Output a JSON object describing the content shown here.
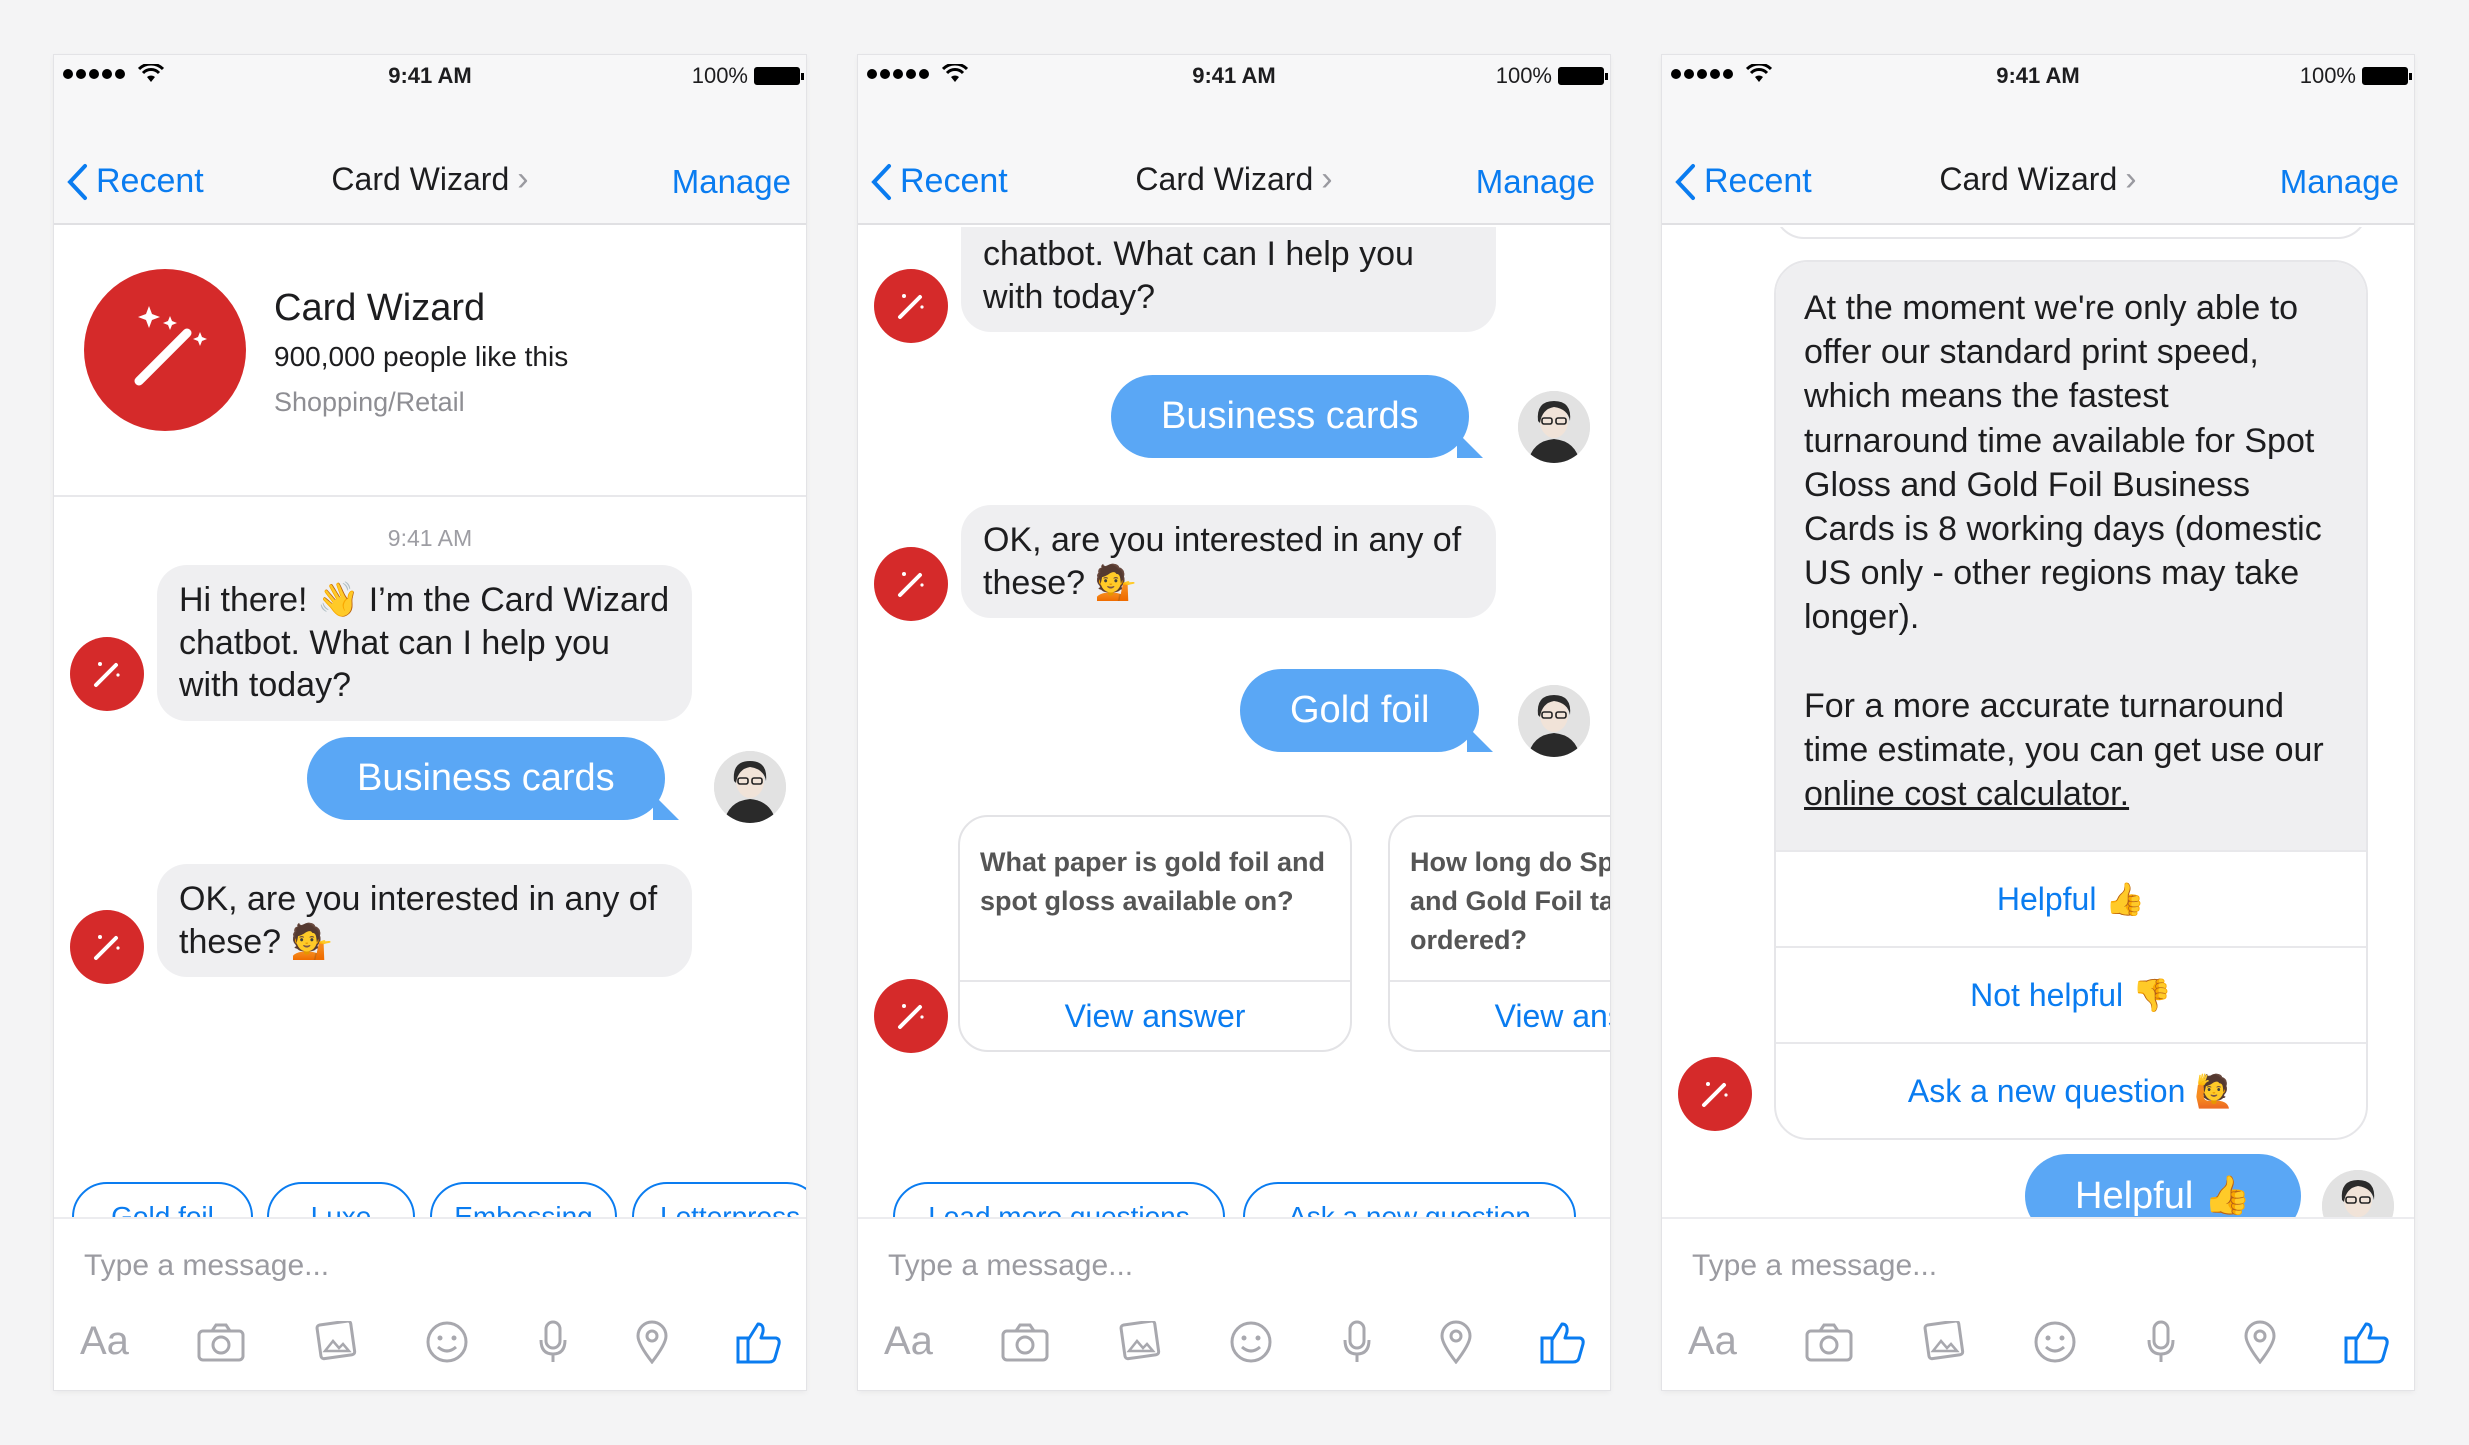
{
  "status": {
    "time": "9:41 AM",
    "battery": "100%"
  },
  "nav": {
    "back": "Recent",
    "title": "Card Wizard",
    "manage": "Manage"
  },
  "input_placeholder": "Type a message...",
  "aa": "Aa",
  "accent": "#0a7cf0",
  "bot_color": "#d52a2a",
  "user_bubble_color": "#5aa7f5",
  "screen1": {
    "profile": {
      "name": "Card Wizard",
      "likes": "900,000 people like this",
      "category": "Shopping/Retail"
    },
    "timestamp": "9:41 AM",
    "msg1": "Hi there! 👋 I’m the Card Wizard\nchatbot. What can I help you\nwith today?",
    "user1": "Business cards",
    "msg2": "OK, are you interested in any of\nthese? 💁",
    "quick_replies": [
      "Gold foil",
      "Luxe",
      "Embossing",
      "Letterpress"
    ]
  },
  "screen2": {
    "msg0": "chatbot. What can I help you\nwith today?",
    "user1": "Business cards",
    "msg1": "OK, are you interested in any of\nthese? 💁",
    "user2": "Gold foil",
    "cards": [
      {
        "question": "What paper is gold foil and spot gloss available on?",
        "action": "View answer"
      },
      {
        "question": "How long do Spot Gloss and Gold Foil take once ordered?",
        "action": "View answer"
      }
    ],
    "buttons": [
      "Load more questions",
      "Ask a new question"
    ]
  },
  "screen3": {
    "answer_p1": "At the moment we're only able to\noffer our standard print speed,\nwhich means the fastest\nturnaround time available for Spot\nGloss and Gold Foil Business\nCards is 8 working days (domestic\nUS only - other regions may take\nlonger).",
    "answer_p2": "For a more accurate turnaround\ntime estimate, you can get use our",
    "answer_link": "online cost calculator.",
    "btn_helpful": "Helpful 👍",
    "btn_not_helpful": "Not helpful 👎",
    "btn_ask": "Ask a new question 🙋",
    "user1": "Helpful 👍"
  }
}
